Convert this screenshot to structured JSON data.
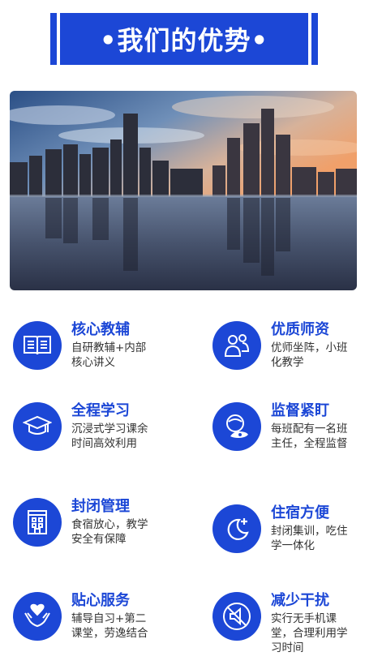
{
  "header": {
    "title": "•我们的优势•"
  },
  "colors": {
    "accent": "#1c47d6",
    "text": "#333333"
  },
  "features": [
    {
      "title": "核心教辅",
      "desc": "自研教辅+内部核心讲义",
      "icon": "book-icon"
    },
    {
      "title": "优质师资",
      "desc": "优师坐阵，小班化教学",
      "icon": "teachers-icon"
    },
    {
      "title": "全程学习",
      "desc": "沉浸式学习课余时间高效利用",
      "icon": "graduation-cap-icon"
    },
    {
      "title": "监督紧盯",
      "desc": "每班配有一名班主任，全程监督",
      "icon": "supervisor-icon"
    },
    {
      "title": "封闭管理",
      "desc": "食宿放心，教学安全有保障",
      "icon": "building-icon"
    },
    {
      "title": "住宿方便",
      "desc": "封闭集训，吃住学一体化",
      "icon": "moon-plus-icon"
    },
    {
      "title": "贴心服务",
      "desc": "辅导自习+第二课堂，劳逸结合",
      "icon": "heart-hands-icon"
    },
    {
      "title": "减少干扰",
      "desc": "实行无手机课堂，合理利用学习时间",
      "icon": "no-speaker-icon"
    }
  ]
}
